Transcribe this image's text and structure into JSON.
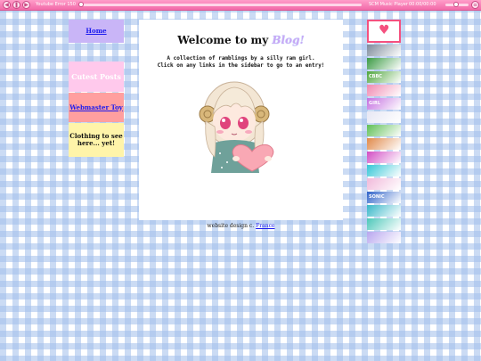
{
  "player": {
    "track": "Youtube Error 150",
    "player_name": "SCM Music Player",
    "time": "00:00/00:00",
    "colors": {
      "bar": "#f26aa8",
      "button": "#ffe3f0"
    }
  },
  "sidebar": {
    "home_label": "Home",
    "cutest_label": "Cutest Posts",
    "webmaster_label": "Webmaster Toy",
    "clothing_label": "Clothing to see here... yet!"
  },
  "main": {
    "title_prefix": "Welcome to my ",
    "title_blog": "Blog!",
    "description_line1": "A collection of ramblings by a silly ram girl.",
    "description_line2": "Click on any links in the sidebar to go to an entry!"
  },
  "footer": {
    "credit_text": "website design c. ",
    "credit_link": "France"
  },
  "stamps": [
    {
      "icon": "heart-stamp-icon",
      "color": "#f5517f",
      "text": ""
    },
    {
      "icon": "clock-stamp-icon",
      "color": "#7d8a9a",
      "text": ""
    },
    {
      "icon": "green-stamp-icon",
      "color": "#3b9a44",
      "text": ""
    },
    {
      "icon": "character-stamp-icon",
      "color": "#4fa63c",
      "text": "CBBC"
    },
    {
      "icon": "pink-anime-stamp-icon",
      "color": "#f088b0",
      "text": ""
    },
    {
      "icon": "girl-stamp-icon",
      "color": "#c46fe0",
      "text": "GIRL"
    },
    {
      "icon": "light-stamp-icon",
      "color": "#e7e7f4",
      "text": ""
    },
    {
      "icon": "game-stamp-icon",
      "color": "#5fbf55",
      "text": ""
    },
    {
      "icon": "orange-anime-stamp-icon",
      "color": "#e0894a",
      "text": ""
    },
    {
      "icon": "magenta-stamp-icon",
      "color": "#d24ec4",
      "text": ""
    },
    {
      "icon": "cyan-stamp-icon",
      "color": "#35c6d6",
      "text": ""
    },
    {
      "icon": "pastel-stamp-icon",
      "color": "#f1b9da",
      "text": ""
    },
    {
      "icon": "sonic-stamp-icon",
      "color": "#2f63c9",
      "text": "SONIC"
    },
    {
      "icon": "teal-stamp-icon",
      "color": "#38b7c8",
      "text": ""
    },
    {
      "icon": "miku-stamp-icon",
      "color": "#4cc7b9",
      "text": ""
    },
    {
      "icon": "lavender-stamp-icon",
      "color": "#b8a6ef",
      "text": ""
    }
  ]
}
